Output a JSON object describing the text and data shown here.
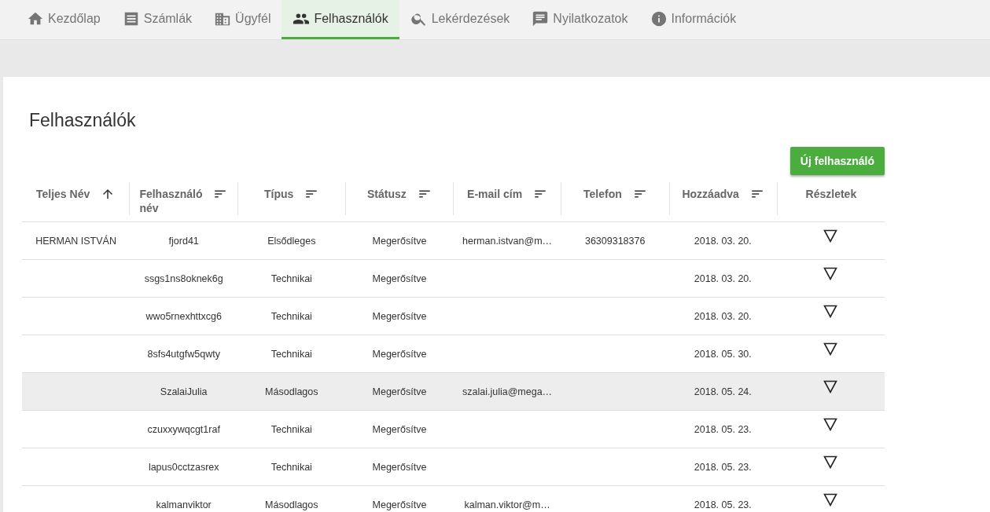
{
  "tabs": [
    {
      "label": "Kezdőlap",
      "selected": false
    },
    {
      "label": "Számlák",
      "selected": false
    },
    {
      "label": "Ügyfél",
      "selected": false
    },
    {
      "label": "Felhasználók",
      "selected": true
    },
    {
      "label": "Lekérdezések",
      "selected": false
    },
    {
      "label": "Nyilatkozatok",
      "selected": false
    },
    {
      "label": "Információk",
      "selected": false
    }
  ],
  "page": {
    "title": "Felhasználók",
    "new_button": "Új felhasználó"
  },
  "table": {
    "columns": [
      {
        "label": "Teljes Név",
        "kind": "sorted"
      },
      {
        "label": "Felhasználó név",
        "kind": "sortable"
      },
      {
        "label": "Típus",
        "kind": "sortable"
      },
      {
        "label": "Státusz",
        "kind": "sortable"
      },
      {
        "label": "E-mail cím",
        "kind": "sortable"
      },
      {
        "label": "Telefon",
        "kind": "sortable"
      },
      {
        "label": "Hozzáadva",
        "kind": "sortable"
      },
      {
        "label": "Részletek",
        "kind": "plain"
      }
    ],
    "rows": [
      {
        "selected": false,
        "cells": [
          "HERMAN ISTVÁN",
          "fjord41",
          "Elsődleges",
          "Megerősítve",
          "herman.istvan@m…",
          "36309318376",
          "2018. 03. 20."
        ]
      },
      {
        "selected": false,
        "cells": [
          "",
          "ssgs1ns8oknek6g",
          "Technikai",
          "Megerősítve",
          "",
          "",
          "2018. 03. 20."
        ]
      },
      {
        "selected": false,
        "cells": [
          "",
          "wwo5rnexhttxcg6",
          "Technikai",
          "Megerősítve",
          "",
          "",
          "2018. 03. 20."
        ]
      },
      {
        "selected": false,
        "cells": [
          "",
          "8sfs4utgfw5qwty",
          "Technikai",
          "Megerősítve",
          "",
          "",
          "2018. 05. 30."
        ]
      },
      {
        "selected": true,
        "cells": [
          "",
          "SzalaiJulia",
          "Másodlagos",
          "Megerősítve",
          "szalai.julia@mega…",
          "",
          "2018. 05. 24."
        ]
      },
      {
        "selected": false,
        "cells": [
          "",
          "czuxxywqcgt1raf",
          "Technikai",
          "Megerősítve",
          "",
          "",
          "2018. 05. 23."
        ]
      },
      {
        "selected": false,
        "cells": [
          "",
          "lapus0cctzasrex",
          "Technikai",
          "Megerősítve",
          "",
          "",
          "2018. 05. 23."
        ]
      },
      {
        "selected": false,
        "cells": [
          "",
          "kalmanviktor",
          "Másodlagos",
          "Megerősítve",
          "kalman.viktor@m…",
          "",
          "2018. 05. 23."
        ]
      }
    ]
  }
}
